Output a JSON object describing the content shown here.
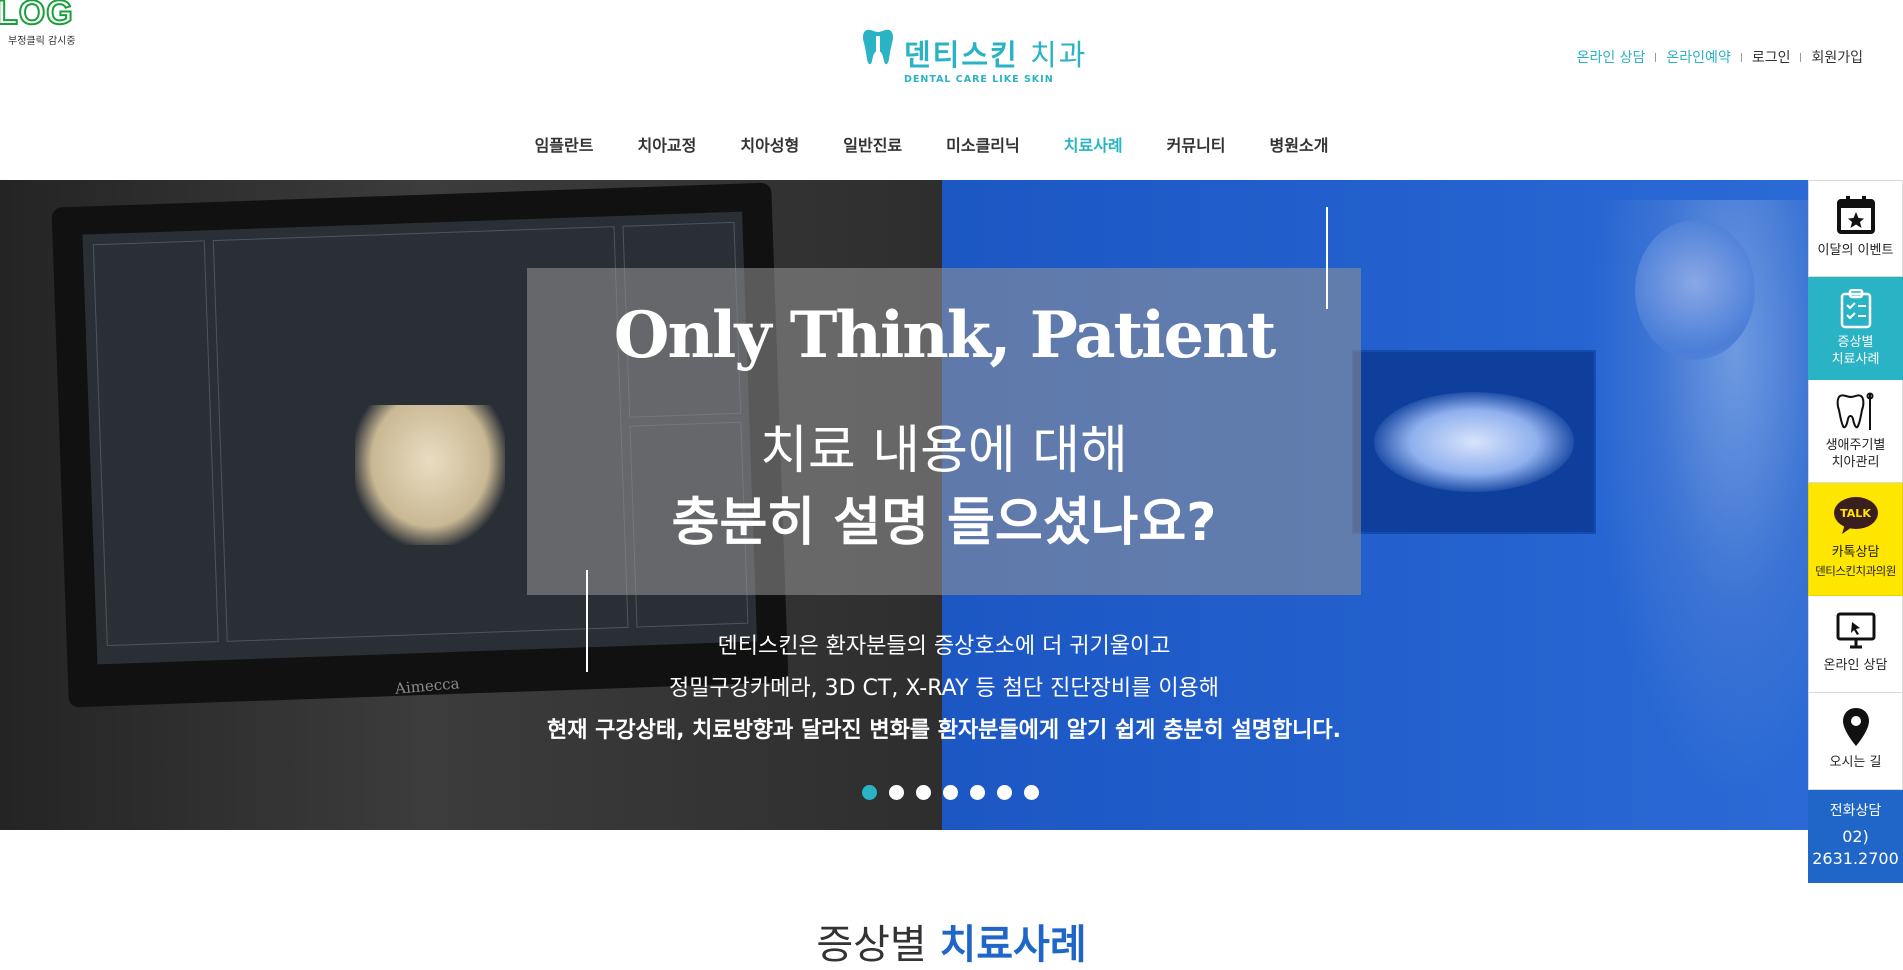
{
  "badge": {
    "logo": "LOG",
    "text": "부정클릭 감시중"
  },
  "brand": {
    "name_bold": "덴티스킨",
    "name_light": "치과",
    "tagline": "DENTAL CARE LIKE SKIN"
  },
  "util_links": [
    {
      "label": "온라인 상담"
    },
    {
      "label": "온라인예약"
    },
    {
      "label": "로그인"
    },
    {
      "label": "회원가입"
    }
  ],
  "nav": [
    {
      "label": "임플란트"
    },
    {
      "label": "치아교정"
    },
    {
      "label": "치아성형"
    },
    {
      "label": "일반진료"
    },
    {
      "label": "미소클리닉"
    },
    {
      "label": "치료사례"
    },
    {
      "label": "커뮤니티"
    },
    {
      "label": "병원소개"
    }
  ],
  "hero": {
    "title": "Only Think, Patient",
    "subtitle_1": "치료 내용에 대해",
    "subtitle_2": "충분히 설명 들으셨나요?",
    "desc_1": "덴티스킨은 환자분들의 증상호소에 더 귀기울이고",
    "desc_2": "정밀구강카메라, 3D CT, X-RAY 등 첨단 진단장비를 이용해",
    "desc_3": "현재 구강상태, 치료방향과 달라진 변화를 환자분들에게 알기 쉽게 충분히 설명합니다.",
    "monitor_brand": "Aimecca",
    "slide_count": 7,
    "active_slide": 1
  },
  "quick_menu": {
    "event": "이달의 이벤트",
    "cases_1": "증상별",
    "cases_2": "치료사례",
    "lifecycle_1": "생애주기별",
    "lifecycle_2": "치아관리",
    "kakao_icon": "TALK",
    "kakao_1": "카톡상담",
    "kakao_2": "덴티스킨치과의원",
    "online": "온라인 상담",
    "map": "오시는 길",
    "phone_label": "전화상담",
    "phone_1": "02)",
    "phone_2": "2631.2700"
  },
  "section": {
    "title_1": "증상별",
    "title_2": "치료사례"
  },
  "colors": {
    "accent": "#2ab3c4",
    "blue": "#1f66c8",
    "kakao": "#ffe600"
  }
}
